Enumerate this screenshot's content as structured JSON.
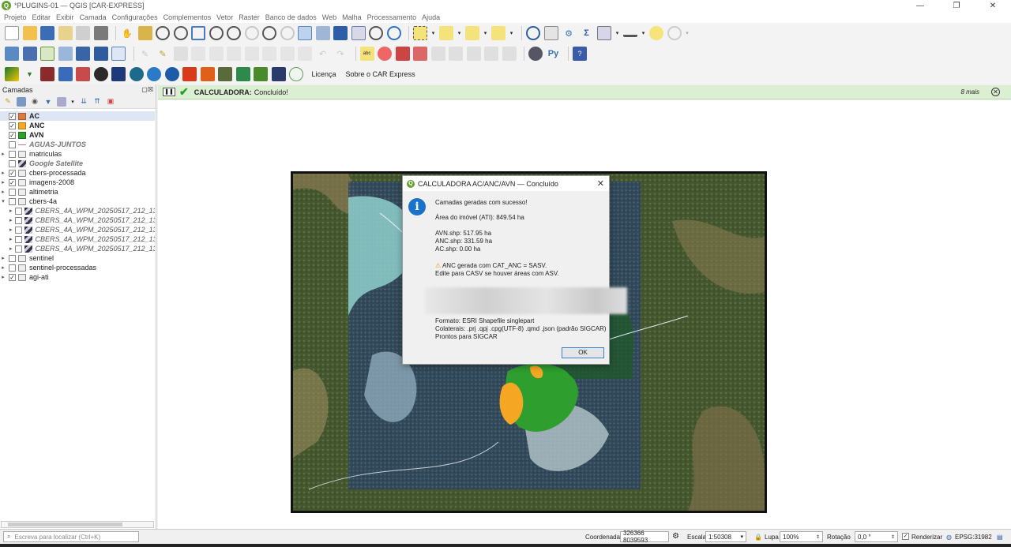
{
  "window": {
    "title": "*PLUGINS-01 — QGIS [CAR-EXPRESS]",
    "logo_letter": "Q",
    "controls": [
      "—",
      "❐",
      "✕"
    ]
  },
  "menu": [
    "Projeto",
    "Editar",
    "Exibir",
    "Camada",
    "Configurações",
    "Complementos",
    "Vetor",
    "Raster",
    "Banco de dados",
    "Web",
    "Malha",
    "Processamento",
    "Ajuda"
  ],
  "toolbar3_links": {
    "license": "Licença",
    "about": "Sobre o CAR Express"
  },
  "layers_panel": {
    "title": "Camadas",
    "header_buttons": "▢☒",
    "layers": [
      {
        "name": "AC",
        "checked": true,
        "kind": "fill",
        "color": "#e07a3a",
        "bold": true,
        "selected": true
      },
      {
        "name": "ANC",
        "checked": true,
        "kind": "fill",
        "color": "#f5a623",
        "bold": true
      },
      {
        "name": "AVN",
        "checked": true,
        "kind": "fill",
        "color": "#2e9e2e",
        "bold": true
      },
      {
        "name": "AGUAS-JUNTOS",
        "checked": false,
        "kind": "line",
        "italic": true
      },
      {
        "name": "matriculas",
        "checked": false,
        "kind": "group",
        "expander": "▸"
      },
      {
        "name": "Google Satellite",
        "checked": false,
        "kind": "raster",
        "italic": true
      },
      {
        "name": "cbers-processada",
        "checked": true,
        "kind": "group",
        "expander": "▸"
      },
      {
        "name": "imagens-2008",
        "checked": true,
        "kind": "group",
        "expander": "▸"
      },
      {
        "name": "altimetria",
        "checked": false,
        "kind": "group",
        "expander": "▸"
      },
      {
        "name": "cbers-4a",
        "checked": false,
        "kind": "group",
        "expander": "▾"
      },
      {
        "name": "CBERS_4A_WPM_20250517_212_135_",
        "checked": false,
        "kind": "raster",
        "italic": true,
        "indent": true,
        "expander": "▸"
      },
      {
        "name": "CBERS_4A_WPM_20250517_212_135_",
        "checked": false,
        "kind": "raster",
        "italic": true,
        "indent": true,
        "expander": "▸"
      },
      {
        "name": "CBERS_4A_WPM_20250517_212_135_",
        "checked": false,
        "kind": "raster",
        "italic": true,
        "indent": true,
        "expander": "▸"
      },
      {
        "name": "CBERS_4A_WPM_20250517_212_135_",
        "checked": false,
        "kind": "raster",
        "italic": true,
        "indent": true,
        "expander": "▸"
      },
      {
        "name": "CBERS_4A_WPM_20250517_212_135_",
        "checked": false,
        "kind": "raster",
        "italic": true,
        "indent": true,
        "expander": "▸"
      },
      {
        "name": "sentinel",
        "checked": false,
        "kind": "group",
        "expander": "▸"
      },
      {
        "name": "sentinel-processadas",
        "checked": false,
        "kind": "group",
        "expander": "▸"
      },
      {
        "name": "agi-ati",
        "checked": true,
        "kind": "group",
        "expander": "▸"
      }
    ]
  },
  "message_bar": {
    "title": "CALCULADORA:",
    "text": "Concluído!",
    "more": "8 mais"
  },
  "dialog": {
    "title": "CALCULADORA AC/ANC/AVN — Concluído",
    "lines": [
      "Camadas geradas com sucesso!",
      "Área do imóvel (ATI): 849.54 ha",
      "AVN.shp: 517.95 ha",
      "ANC.shp: 331.59 ha",
      "AC.shp: 0.00 ha",
      "ANC gerada com CAT_ANC = SASV.",
      "Edite para CASV se houver áreas com ASV.",
      "Formato: ESRI Shapefile singlepart",
      "Colaterais: .prj .qpj .cpg(UTF-8) .qmd .json (padrão SIGCAR)",
      "Prontos para SIGCAR"
    ],
    "ok_label": "OK"
  },
  "status_bar": {
    "locator_placeholder": "Escreva para localizar (Ctrl+K)",
    "coord_label": "Coordenada",
    "coord_value": "326366  8039593",
    "scale_label": "Escala",
    "scale_value": "1:50308",
    "magnifier_label": "Lupa",
    "magnifier_value": "100%",
    "rotation_label": "Rotação",
    "rotation_value": "0,0 °",
    "render_label": "Renderizar",
    "render_checked": true,
    "crs": "EPSG:31982"
  }
}
